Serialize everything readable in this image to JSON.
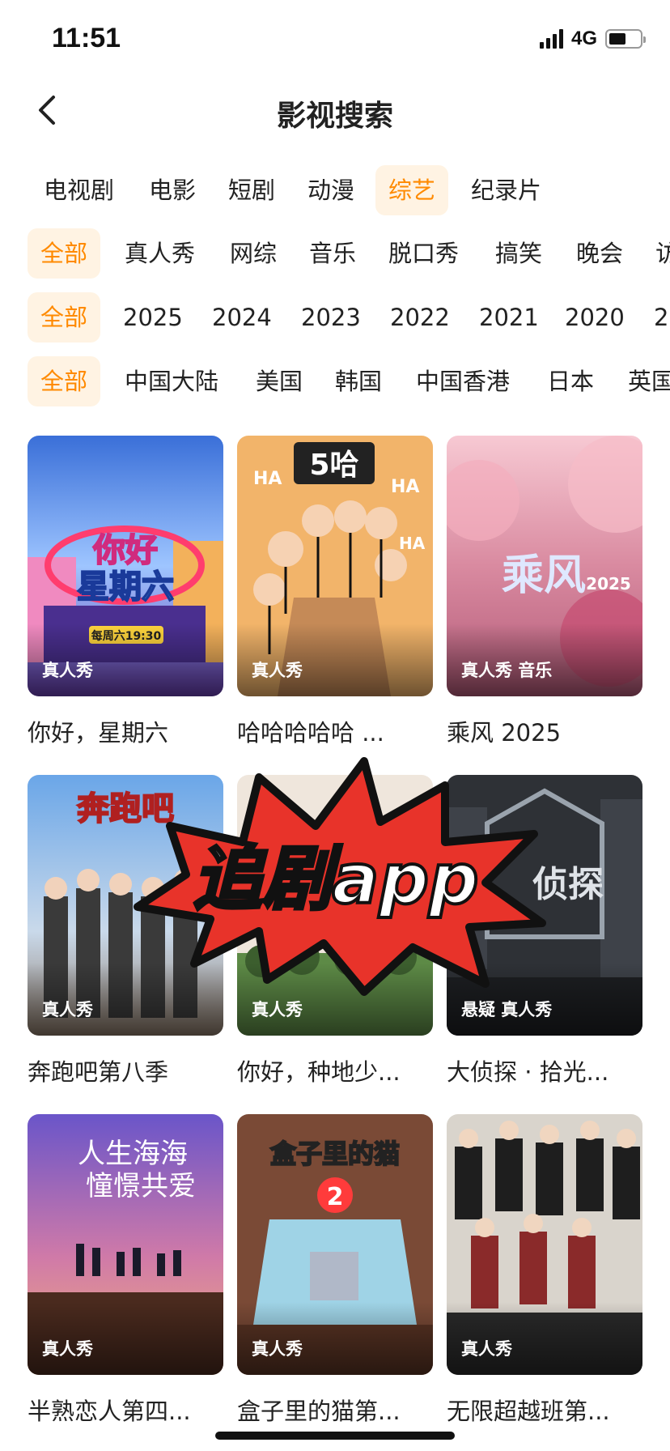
{
  "status": {
    "time": "11:51",
    "network": "4G"
  },
  "nav": {
    "title": "影视搜索"
  },
  "categories": [
    "电视剧",
    "电影",
    "短剧",
    "动漫",
    "综艺",
    "纪录片"
  ],
  "genres": [
    "全部",
    "真人秀",
    "网综",
    "音乐",
    "脱口秀",
    "搞笑",
    "晚会",
    "访"
  ],
  "years": [
    "全部",
    "2025",
    "2024",
    "2023",
    "2022",
    "2021",
    "2020",
    "20"
  ],
  "regions": [
    "全部",
    "中国大陆",
    "美国",
    "韩国",
    "中国香港",
    "日本",
    "英国"
  ],
  "shows": [
    {
      "title": "你好，星期六",
      "tag": "真人秀"
    },
    {
      "title": "哈哈哈哈哈 ...",
      "tag": "真人秀"
    },
    {
      "title": "乘风 2025",
      "tag": "真人秀 音乐"
    },
    {
      "title": "奔跑吧第八季",
      "tag": "真人秀"
    },
    {
      "title": "你好，种地少...",
      "tag": "真人秀"
    },
    {
      "title": "大侦探 · 拾光...",
      "tag": "悬疑 真人秀"
    },
    {
      "title": "半熟恋人第四...",
      "tag": "真人秀"
    },
    {
      "title": "盒子里的猫第...",
      "tag": "真人秀"
    },
    {
      "title": "无限超越班第...",
      "tag": "真人秀"
    }
  ],
  "overlay": {
    "text": "追剧app"
  }
}
